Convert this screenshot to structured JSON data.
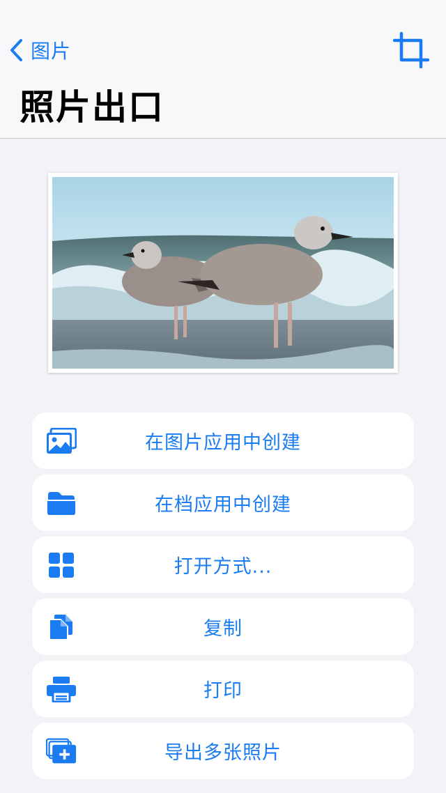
{
  "nav": {
    "back_label": "图片"
  },
  "page": {
    "title": "照片出口"
  },
  "colors": {
    "accent": "#1a7cf0",
    "background": "#f2f2f7",
    "row_background": "#ffffff"
  },
  "actions": [
    {
      "label": "在图片应用中创建",
      "icon": "photo-icon"
    },
    {
      "label": "在档应用中创建",
      "icon": "folder-icon"
    },
    {
      "label": "打开方式...",
      "icon": "grid-icon"
    },
    {
      "label": "复制",
      "icon": "copy-icon"
    },
    {
      "label": "打印",
      "icon": "printer-icon"
    },
    {
      "label": "导出多张照片",
      "icon": "stacked-photos-add-icon"
    }
  ]
}
